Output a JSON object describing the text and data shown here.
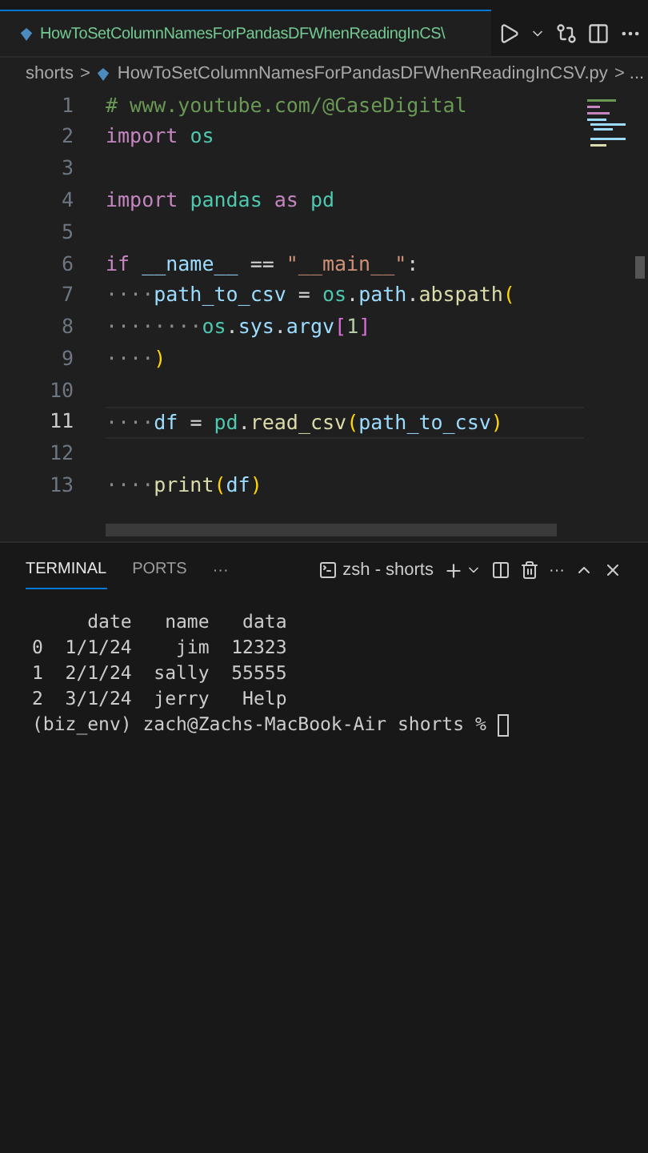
{
  "editor_tab": {
    "title": "HowToSetColumnNamesForPandasDFWhenReadingInCS\\"
  },
  "breadcrumb": {
    "folder": "shorts",
    "separator": ">",
    "file": "HowToSetColumnNamesForPandasDFWhenReadingInCSV.py",
    "tail": "> ..."
  },
  "code_lines": [
    {
      "number": "1",
      "current": false,
      "tokens": [
        {
          "kind": "comment",
          "text": "# www.youtube.com/@CaseDigital"
        }
      ]
    },
    {
      "number": "2",
      "current": false,
      "tokens": [
        {
          "kind": "keyword",
          "text": "import "
        },
        {
          "kind": "module",
          "text": "os"
        }
      ]
    },
    {
      "number": "3",
      "current": false
    },
    {
      "number": "4",
      "current": false,
      "tokens": [
        {
          "kind": "keyword",
          "text": "import "
        },
        {
          "kind": "module",
          "text": "pandas "
        },
        {
          "kind": "keyword",
          "text": "as "
        },
        {
          "kind": "module",
          "text": "pd"
        }
      ]
    },
    {
      "number": "5",
      "current": false
    },
    {
      "number": "6",
      "current": false,
      "tokens": [
        {
          "kind": "keyword",
          "text": "if "
        },
        {
          "kind": "variable",
          "text": "__name__"
        },
        {
          "kind": "plain",
          "text": " == "
        },
        {
          "kind": "string",
          "text": "\"__main__\""
        },
        {
          "kind": "plain",
          "text": ":"
        }
      ]
    },
    {
      "number": "7",
      "current": false,
      "tokens": [
        {
          "kind": "whitespace",
          "text": "····"
        },
        {
          "kind": "variable",
          "text": "path_to_csv"
        },
        {
          "kind": "plain",
          "text": " = "
        },
        {
          "kind": "module",
          "text": "os"
        },
        {
          "kind": "plain",
          "text": "."
        },
        {
          "kind": "variable",
          "text": "path"
        },
        {
          "kind": "plain",
          "text": "."
        },
        {
          "kind": "function",
          "text": "abspath"
        },
        {
          "kind": "bracket",
          "text": "("
        }
      ]
    },
    {
      "number": "8",
      "current": false,
      "tokens": [
        {
          "kind": "whitespace",
          "text": "········"
        },
        {
          "kind": "module",
          "text": "os"
        },
        {
          "kind": "plain",
          "text": "."
        },
        {
          "kind": "variable",
          "text": "sys"
        },
        {
          "kind": "plain",
          "text": "."
        },
        {
          "kind": "variable",
          "text": "argv"
        },
        {
          "kind": "bracket2",
          "text": "["
        },
        {
          "kind": "number",
          "text": "1"
        },
        {
          "kind": "bracket2",
          "text": "]"
        }
      ]
    },
    {
      "number": "9",
      "current": false,
      "tokens": [
        {
          "kind": "whitespace",
          "text": "····"
        },
        {
          "kind": "bracket",
          "text": ")"
        }
      ]
    },
    {
      "number": "10",
      "current": false
    },
    {
      "number": "11",
      "current": true,
      "tokens": [
        {
          "kind": "whitespace",
          "text": "····"
        },
        {
          "kind": "variable",
          "text": "df"
        },
        {
          "kind": "plain",
          "text": " = "
        },
        {
          "kind": "module",
          "text": "pd"
        },
        {
          "kind": "plain",
          "text": "."
        },
        {
          "kind": "function",
          "text": "read_csv"
        },
        {
          "kind": "bracket",
          "text": "("
        },
        {
          "kind": "variable",
          "text": "path_to_csv"
        },
        {
          "kind": "bracket",
          "text": ")"
        }
      ]
    },
    {
      "number": "12",
      "current": false
    },
    {
      "number": "13",
      "current": false,
      "tokens": [
        {
          "kind": "whitespace",
          "text": "····"
        },
        {
          "kind": "function",
          "text": "print"
        },
        {
          "kind": "bracket",
          "text": "("
        },
        {
          "kind": "variable",
          "text": "df"
        },
        {
          "kind": "bracket",
          "text": ")"
        }
      ]
    }
  ],
  "panel": {
    "tabs": [
      {
        "label": "TERMINAL",
        "selected": true
      },
      {
        "label": "PORTS",
        "selected": false
      }
    ],
    "more": "···",
    "shell": "zsh - shorts",
    "more_actions": "···"
  },
  "terminal_lines": [
    "     date   name   data",
    "0  1/1/24    jim  12323",
    "1  2/1/24  sally  55555",
    "2  3/1/24  jerry   Help",
    "(biz_env) zach@Zachs-MacBook-Air shorts % "
  ]
}
